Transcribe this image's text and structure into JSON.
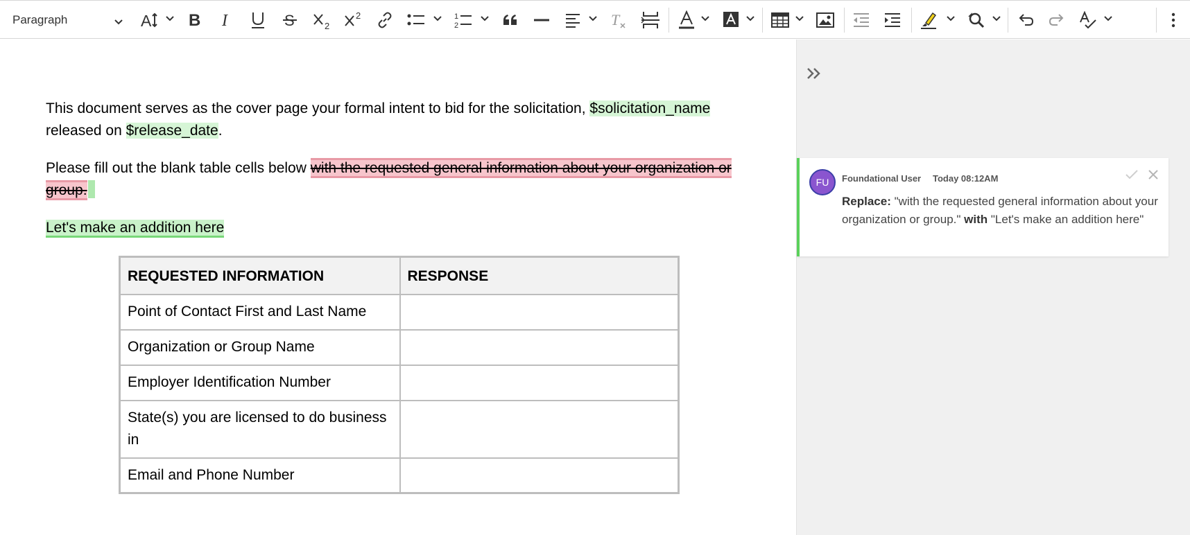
{
  "toolbar": {
    "paragraph_style": "Paragraph",
    "tools": [
      {
        "name": "text-size",
        "icon": "text-size-icon",
        "dropdown": true
      },
      {
        "name": "bold",
        "icon": "bold-icon"
      },
      {
        "name": "italic",
        "icon": "italic-icon"
      },
      {
        "name": "underline",
        "icon": "underline-icon"
      },
      {
        "name": "strikethrough",
        "icon": "strikethrough-icon"
      },
      {
        "name": "subscript",
        "icon": "subscript-icon"
      },
      {
        "name": "superscript",
        "icon": "superscript-icon"
      },
      {
        "name": "link",
        "icon": "link-icon"
      },
      {
        "name": "bulleted-list",
        "icon": "bulleted-list-icon",
        "dropdown": true
      },
      {
        "name": "numbered-list",
        "icon": "numbered-list-icon",
        "dropdown": true
      },
      {
        "name": "block-quote",
        "icon": "quote-icon"
      },
      {
        "name": "horizontal-line",
        "icon": "horizontal-line-icon"
      },
      {
        "name": "text-alignment",
        "icon": "align-left-icon",
        "dropdown": true
      },
      {
        "name": "remove-format",
        "icon": "remove-format-icon"
      },
      {
        "name": "page-break",
        "icon": "page-break-icon"
      },
      {
        "name": "font-color",
        "icon": "font-color-icon",
        "dropdown": true
      },
      {
        "name": "font-background-color",
        "icon": "font-background-icon",
        "dropdown": true
      },
      {
        "name": "insert-table",
        "icon": "table-icon",
        "dropdown": true
      },
      {
        "name": "insert-image",
        "icon": "image-icon"
      },
      {
        "name": "outdent",
        "icon": "outdent-icon"
      },
      {
        "name": "indent",
        "icon": "indent-icon"
      },
      {
        "name": "highlight",
        "icon": "highlighter-icon",
        "dropdown": true
      },
      {
        "name": "find-replace",
        "icon": "find-replace-icon",
        "dropdown": true
      },
      {
        "name": "undo",
        "icon": "undo-icon"
      },
      {
        "name": "redo",
        "icon": "redo-icon"
      },
      {
        "name": "track-changes",
        "icon": "spellcheck-icon",
        "dropdown": true
      },
      {
        "name": "more",
        "icon": "more-vertical-icon"
      }
    ],
    "colors": {
      "icon": "#333333",
      "disabled": "#9a9a9a"
    }
  },
  "document": {
    "para1": {
      "text_a": "This document serves as the cover page your formal intent to bid for the solicitation, ",
      "var_solicitation": "$solicitation_name",
      "text_b": " released on ",
      "var_release": "$release_date",
      "text_c": "."
    },
    "para2": {
      "text_a": "Please fill out the blank table cells below ",
      "deleted": "with the requested general information about your organization or group."
    },
    "para3": {
      "inserted": "Let's make an addition here"
    },
    "table": {
      "headers": [
        "REQUESTED INFORMATION",
        "RESPONSE"
      ],
      "rows": [
        [
          "Point of Contact First and Last Name",
          ""
        ],
        [
          "Organization or Group Name",
          ""
        ],
        [
          "Employer Identification Number",
          ""
        ],
        [
          "State(s) you are licensed to do business in",
          ""
        ],
        [
          "Email and Phone Number",
          ""
        ]
      ]
    },
    "colors": {
      "variable_bg": "#d6f5d6",
      "deletion_bg": "#f7c5cc",
      "insertion_bg": "#c9f2c9",
      "insertion_underline": "#78d778"
    }
  },
  "sidebar": {
    "collapse_icon": "double-chevron-right-icon",
    "suggestion": {
      "avatar_initials": "FU",
      "avatar_color": "#8a55cf",
      "author": "Foundational User",
      "time": "Today 08:12AM",
      "action_label": "Replace:",
      "old_text": " \"with the requested general information about your organization or group.\" ",
      "connector": "with",
      "new_text": " \"Let's make an addition here\"",
      "accept_icon": "checkmark-icon",
      "discard_icon": "close-icon",
      "accent": "#5bd15b"
    }
  }
}
